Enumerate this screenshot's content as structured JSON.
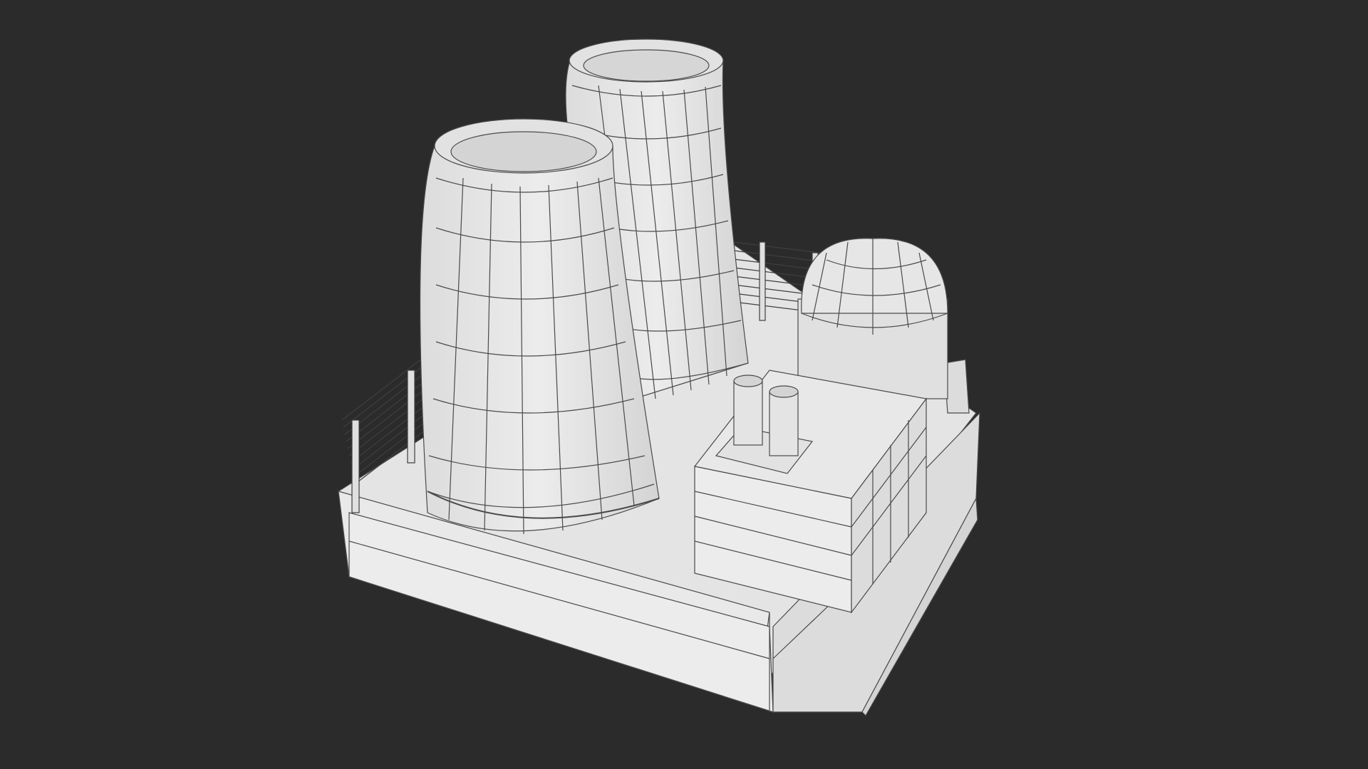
{
  "scene": {
    "background_color": "#2b2b2b",
    "model_fill": "#e8e8e8",
    "model_shadow_fill": "#d9d9d9",
    "wire_color": "#4a4a4a",
    "objects": [
      "cooling-tower-front",
      "cooling-tower-back",
      "reactor-dome",
      "turbine-building",
      "exhaust-stacks",
      "perimeter-fence",
      "base-platform"
    ]
  }
}
